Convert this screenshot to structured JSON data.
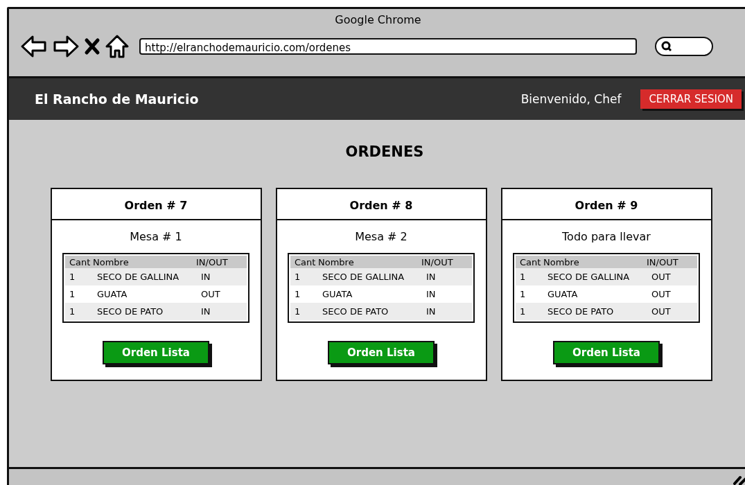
{
  "window": {
    "title": "Google Chrome"
  },
  "address_bar": {
    "value": "http://elranchodemauricio.com/ordenes"
  },
  "navbar": {
    "brand": "El Rancho de Mauricio",
    "greeting": "Bienvenido, Chef",
    "logout_button": "CERRAR SESION"
  },
  "heading": "ORDENES",
  "orders": [
    {
      "title": "Orden # 7",
      "subtitle": "Mesa # 1",
      "columns": [
        "Cant",
        "Nombre",
        "IN/OUT"
      ],
      "rows": [
        [
          "1",
          "SECO DE GALLINA",
          "IN"
        ],
        [
          "1",
          "GUATA",
          "OUT"
        ],
        [
          "1",
          "SECO DE PATO",
          "IN"
        ]
      ],
      "button": "Orden Lista"
    },
    {
      "title": "Orden # 8",
      "subtitle": "Mesa # 2",
      "columns": [
        "Cant",
        "Nombre",
        "IN/OUT"
      ],
      "rows": [
        [
          "1",
          "SECO DE GALLINA",
          "IN"
        ],
        [
          "1",
          "GUATA",
          "IN"
        ],
        [
          "1",
          "SECO DE PATO",
          "IN"
        ]
      ],
      "button": "Orden Lista"
    },
    {
      "title": "Orden # 9",
      "subtitle": "Todo para llevar",
      "columns": [
        "Cant",
        "Nombre",
        "IN/OUT"
      ],
      "rows": [
        [
          "1",
          "SECO DE GALLINA",
          "OUT"
        ],
        [
          "1",
          "GUATA",
          "OUT"
        ],
        [
          "1",
          "SECO DE PATO",
          "OUT"
        ]
      ],
      "button": "Orden Lista"
    }
  ]
}
